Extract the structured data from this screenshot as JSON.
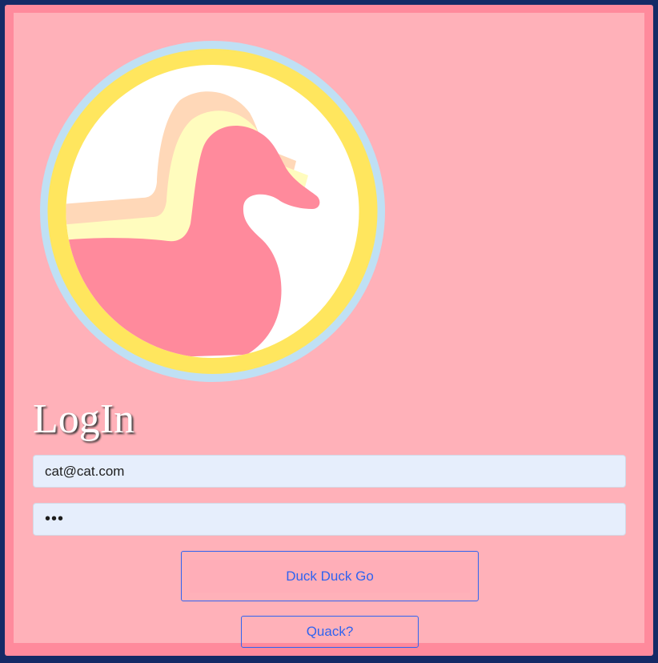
{
  "logo": {
    "icon": "duck-icon",
    "colors": {
      "outer_ring": "#bfe0f4",
      "ring": "#ffe65e",
      "inner": "#ffffff",
      "duck": "#ff8a9c",
      "shadow_yellow": "#fffcbe",
      "shadow_peach": "#ffd8b8"
    }
  },
  "form": {
    "title": "LogIn",
    "email_value": "cat@cat.com",
    "password_value": "•••",
    "submit_label": "Duck Duck Go",
    "secondary_label": "Quack?"
  },
  "colors": {
    "page_background": "#142a66",
    "frame": "#ff8a9c",
    "panel": "#ffb1b9",
    "input_background": "#e6eefc",
    "button_accent": "#2f63f0"
  }
}
